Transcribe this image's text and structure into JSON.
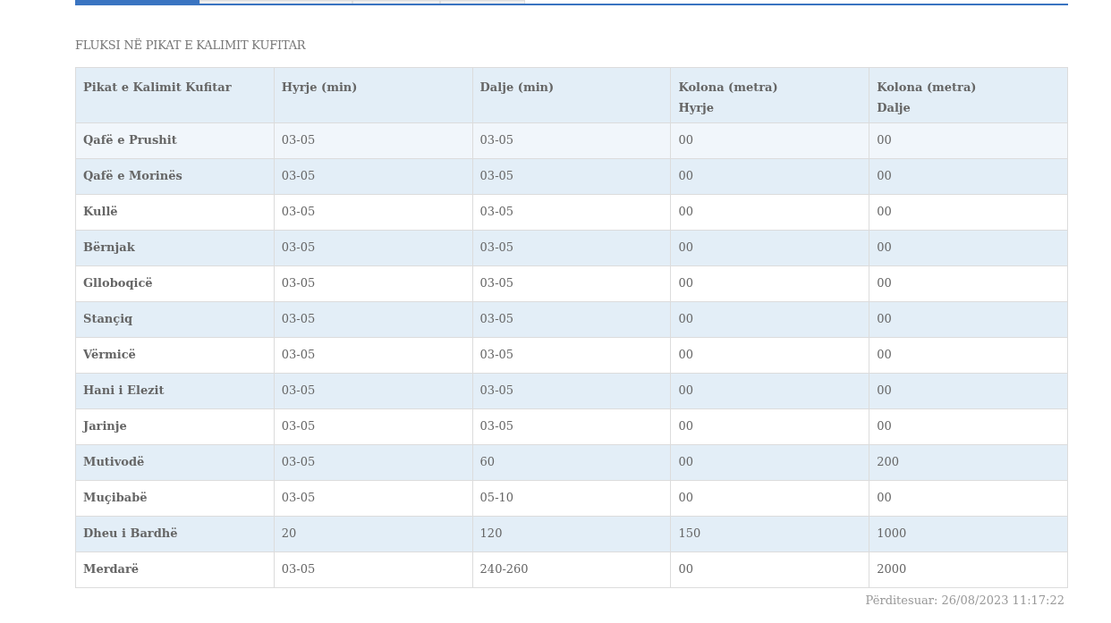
{
  "tabs": [
    {
      "selected": true
    },
    {
      "selected": false
    },
    {
      "selected": false
    },
    {
      "selected": false
    }
  ],
  "section_title": "FLUKSI NË PIKAT E KALIMIT KUFITAR",
  "table": {
    "columns": [
      "Pikat e Kalimit Kufitar",
      "Hyrje (min)",
      "Dalje (min)",
      "Kolona (metra)\nHyrje",
      "Kolona (metra)\nDalje"
    ],
    "rows": [
      {
        "highlighted": true,
        "cells": [
          "Qafë e Prushit",
          "03-05",
          "03-05",
          "00",
          "00"
        ]
      },
      {
        "highlighted": false,
        "cells": [
          "Qafë e Morinës",
          "03-05",
          "03-05",
          "00",
          "00"
        ]
      },
      {
        "highlighted": false,
        "cells": [
          "Kullë",
          "03-05",
          "03-05",
          "00",
          "00"
        ]
      },
      {
        "highlighted": false,
        "cells": [
          "Bërnjak",
          "03-05",
          "03-05",
          "00",
          "00"
        ]
      },
      {
        "highlighted": false,
        "cells": [
          "Glloboqicë",
          "03-05",
          "03-05",
          "00",
          "00"
        ]
      },
      {
        "highlighted": false,
        "cells": [
          "Stançiq",
          "03-05",
          "03-05",
          "00",
          "00"
        ]
      },
      {
        "highlighted": false,
        "cells": [
          "Vërmicë",
          "03-05",
          "03-05",
          "00",
          "00"
        ]
      },
      {
        "highlighted": false,
        "cells": [
          "Hani i Elezit",
          "03-05",
          "03-05",
          "00",
          "00"
        ]
      },
      {
        "highlighted": false,
        "cells": [
          "Jarinje",
          "03-05",
          "03-05",
          "00",
          "00"
        ]
      },
      {
        "highlighted": false,
        "cells": [
          "Mutivodë",
          "03-05",
          "60",
          "00",
          "200"
        ]
      },
      {
        "highlighted": false,
        "cells": [
          "Muçibabë",
          "03-05",
          "05-10",
          "00",
          "00"
        ]
      },
      {
        "highlighted": false,
        "cells": [
          "Dheu i Bardhë",
          "20",
          "120",
          "150",
          "1000"
        ]
      },
      {
        "highlighted": false,
        "cells": [
          "Merdarë",
          "03-05",
          "240-260",
          "00",
          "2000"
        ]
      }
    ]
  },
  "updated": "Përditesuar: 26/08/2023 11:17:22"
}
